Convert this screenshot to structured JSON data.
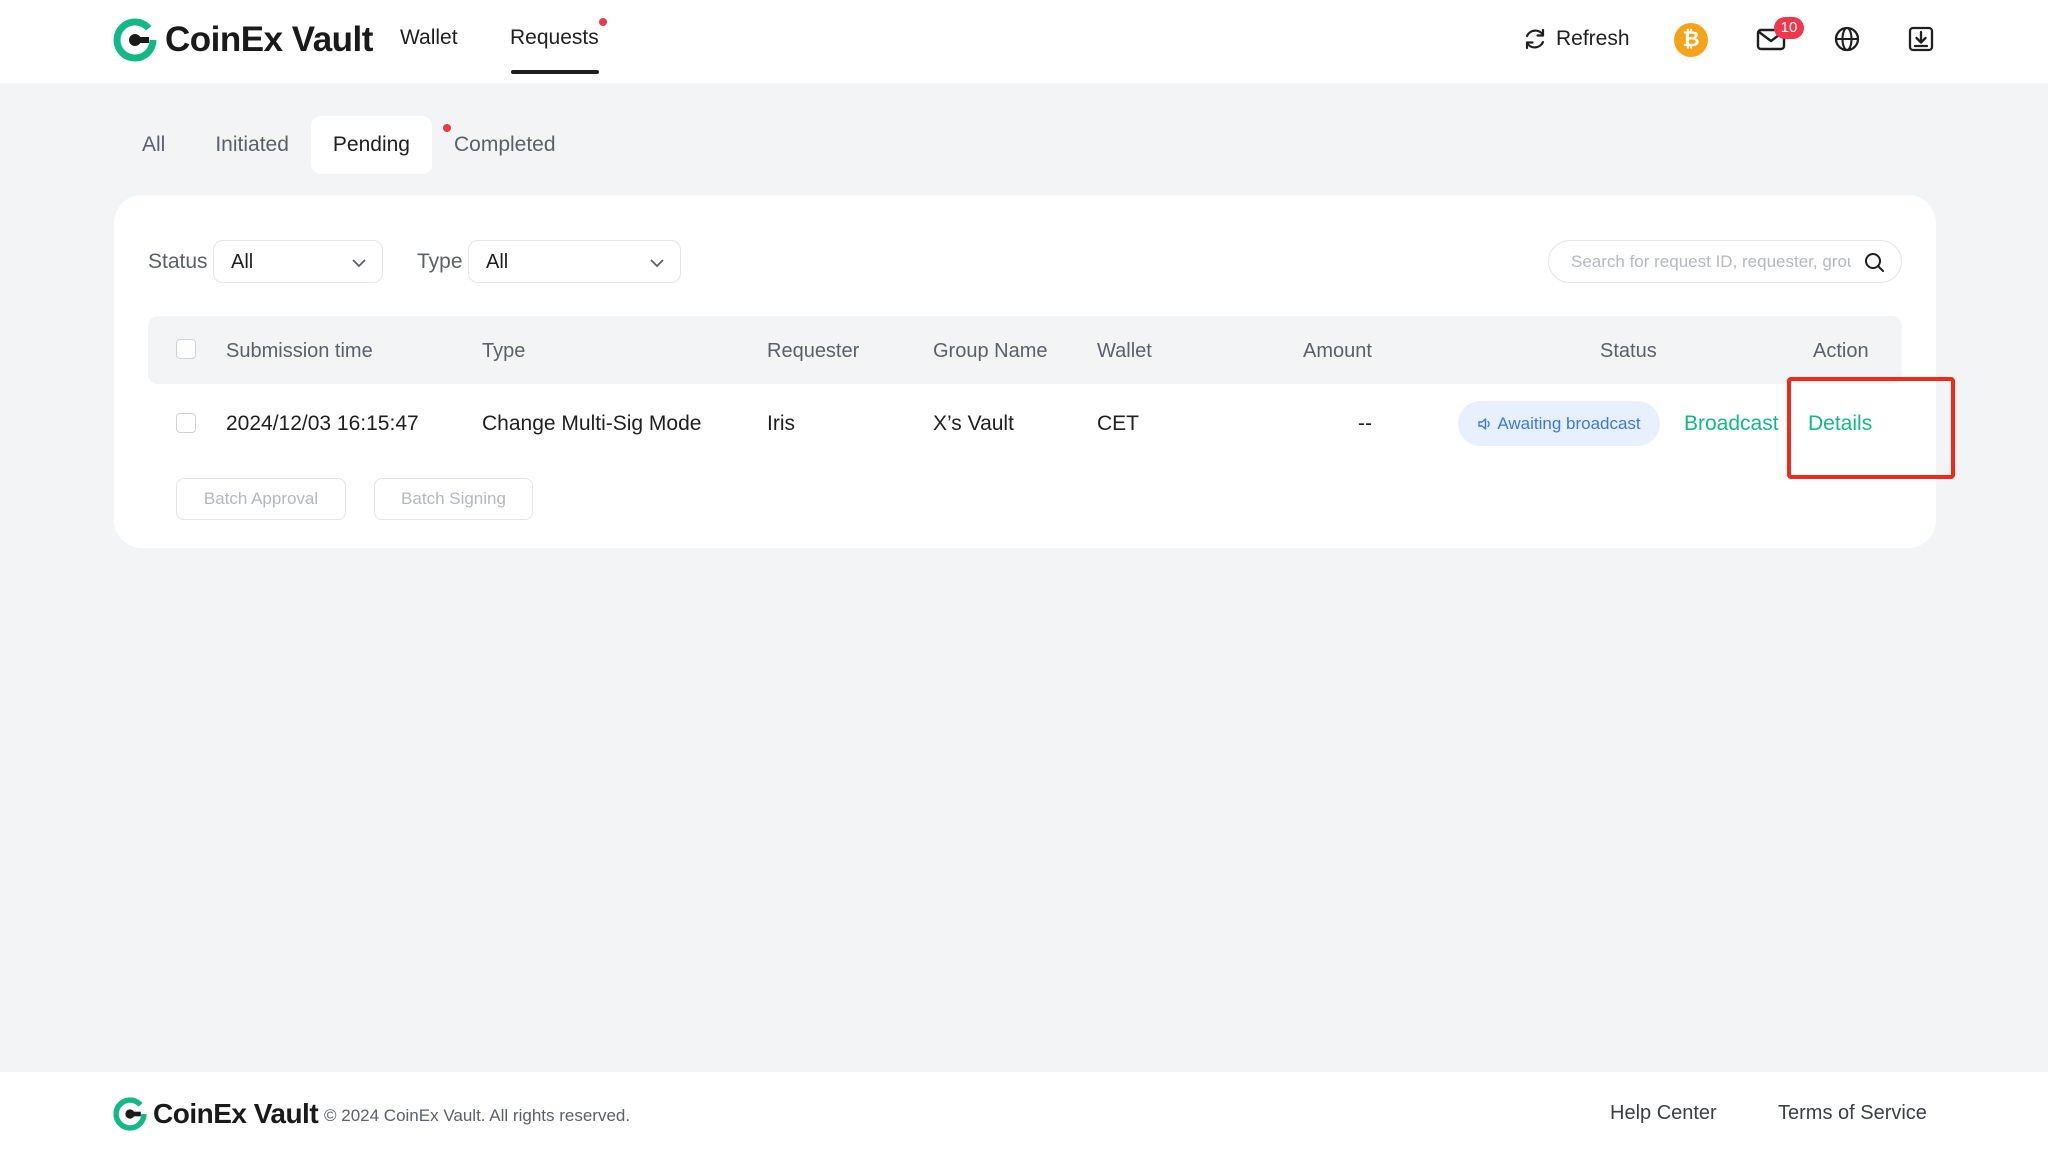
{
  "brand": {
    "name": "CoinEx Vault",
    "accent": "#12b886"
  },
  "nav": {
    "wallet": "Wallet",
    "requests": "Requests"
  },
  "header": {
    "refresh": "Refresh",
    "bitcoin_symbol": "₿",
    "mail_count": "10"
  },
  "tabs": [
    {
      "label": "All"
    },
    {
      "label": "Initiated"
    },
    {
      "label": "Pending"
    },
    {
      "label": "Completed"
    }
  ],
  "filters": {
    "status_label": "Status",
    "status_value": "All",
    "type_label": "Type",
    "type_value": "All",
    "search_placeholder": "Search for request ID, requester, group"
  },
  "table": {
    "columns": [
      "Submission time",
      "Type",
      "Requester",
      "Group Name",
      "Wallet",
      "Amount",
      "Status",
      "Action"
    ],
    "rows": [
      {
        "submission_time": "2024/12/03 16:15:47",
        "type": "Change Multi-Sig Mode",
        "requester": "Iris",
        "group_name": "X’s Vault",
        "wallet": "CET",
        "amount": "--",
        "status": "Awaiting broadcast",
        "action_broadcast": "Broadcast",
        "action_details": "Details"
      }
    ]
  },
  "batch": {
    "approval": "Batch Approval",
    "signing": "Batch Signing"
  },
  "footer": {
    "copyright": "© 2024 CoinEx Vault. All rights reserved.",
    "help_center": "Help Center",
    "terms": "Terms of Service"
  }
}
